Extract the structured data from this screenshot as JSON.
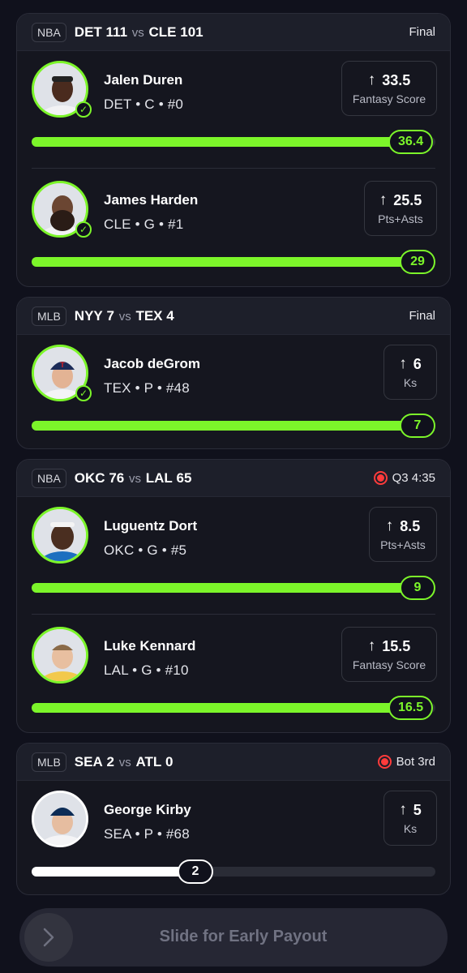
{
  "games": [
    {
      "league": "NBA",
      "team1": "DET",
      "score1": "111",
      "vs": "vs",
      "team2": "CLE",
      "score2": "101",
      "status": "Final",
      "players": [
        {
          "name": "Jalen Duren",
          "meta": "DET • C • #0",
          "line": "33.5",
          "stat": "Fantasy Score",
          "current": "36.4",
          "progress": 1.0
        },
        {
          "name": "James Harden",
          "meta": "CLE • G • #1",
          "line": "25.5",
          "stat": "Pts+Asts",
          "current": "29",
          "progress": 1.0
        }
      ]
    },
    {
      "league": "MLB",
      "team1": "NYY",
      "score1": "7",
      "vs": "vs",
      "team2": "TEX",
      "score2": "4",
      "status": "Final",
      "players": [
        {
          "name": "Jacob deGrom",
          "meta": "TEX • P • #48",
          "line": "6",
          "stat": "Ks",
          "current": "7",
          "progress": 1.0
        }
      ]
    },
    {
      "league": "NBA",
      "team1": "OKC",
      "score1": "76",
      "vs": "vs",
      "team2": "LAL",
      "score2": "65",
      "status": "Q3 4:35",
      "players": [
        {
          "name": "Luguentz Dort",
          "meta": "OKC • G • #5",
          "line": "8.5",
          "stat": "Pts+Asts",
          "current": "9",
          "progress": 1.0
        },
        {
          "name": "Luke Kennard",
          "meta": "LAL • G • #10",
          "line": "15.5",
          "stat": "Fantasy Score",
          "current": "16.5",
          "progress": 1.0
        }
      ]
    },
    {
      "league": "MLB",
      "team1": "SEA",
      "score1": "2",
      "vs": "vs",
      "team2": "ATL",
      "score2": "0",
      "status": "Bot 3rd",
      "players": [
        {
          "name": "George Kirby",
          "meta": "SEA • P • #68",
          "line": "5",
          "stat": "Ks",
          "current": "2",
          "progress": 0.4
        }
      ]
    }
  ],
  "slide_label": "Slide for Early Payout",
  "colors": {
    "accent": "#7cf52a",
    "live": "#ff3b3b",
    "background": "#10111c"
  },
  "icons": {
    "arrow": "arrow-up-icon",
    "check": "check-icon",
    "chevron": "chevron-right-icon",
    "live": "live-indicator-icon"
  }
}
